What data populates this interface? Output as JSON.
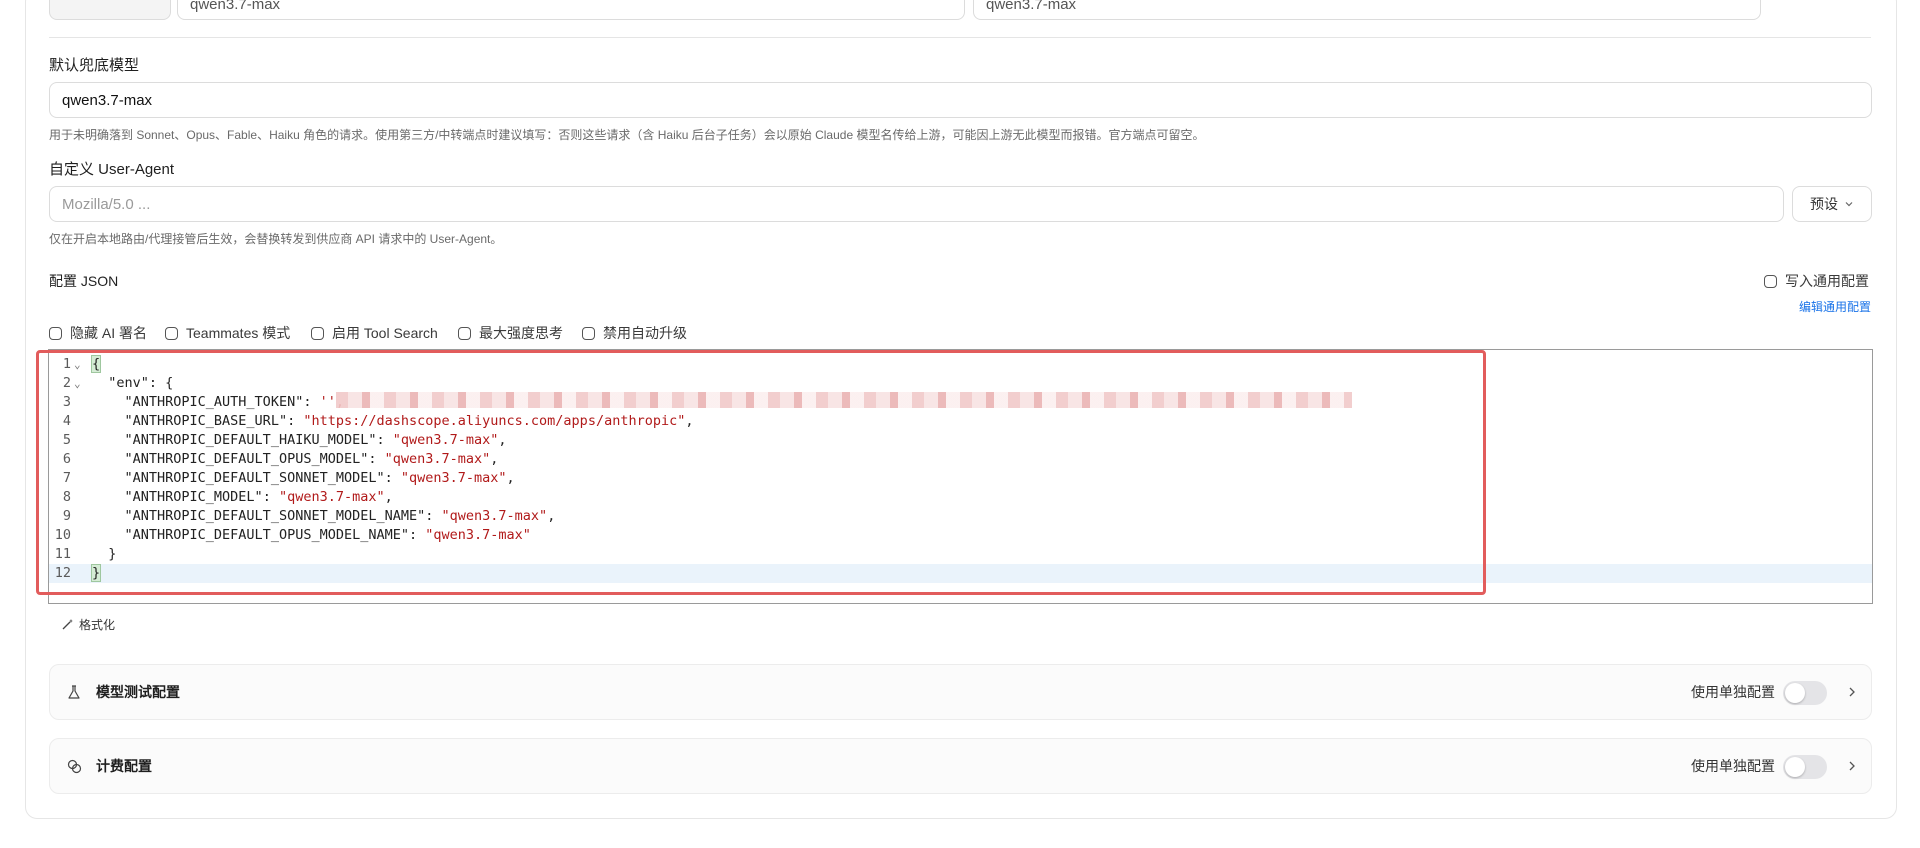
{
  "top_row": {
    "left_value": "qwen3.7-max",
    "right_value": "qwen3.7-max"
  },
  "fallback_model": {
    "label": "默认兜底模型",
    "value": "qwen3.7-max",
    "hint": "用于未明确落到 Sonnet、Opus、Fable、Haiku 角色的请求。使用第三方/中转端点时建议填写：否则这些请求（含 Haiku 后台子任务）会以原始 Claude 模型名传给上游，可能因上游无此模型而报错。官方端点可留空。"
  },
  "user_agent": {
    "label": "自定义 User-Agent",
    "placeholder": "Mozilla/5.0 ...",
    "preset_label": "预设",
    "hint": "仅在开启本地路由/代理接管后生效，会替换转发到供应商 API 请求中的 User-Agent。"
  },
  "config_json": {
    "label": "配置 JSON",
    "write_common_label": "写入通用配置",
    "edit_common_link": "编辑通用配置",
    "options": [
      "隐藏 AI 署名",
      "Teammates 模式",
      "启用 Tool Search",
      "最大强度思考",
      "禁用自动升级"
    ],
    "format_label": "格式化"
  },
  "editor": {
    "lines": [
      {
        "n": "1",
        "fold": true,
        "indent": "",
        "key": "",
        "value": "",
        "text": "{",
        "tail": ""
      },
      {
        "n": "2",
        "fold": true,
        "indent": "  ",
        "key": "\"env\"",
        "value": "",
        "text": ": {",
        "tail": ""
      },
      {
        "n": "3",
        "fold": false,
        "indent": "    ",
        "key": "\"ANTHROPIC_AUTH_TOKEN\"",
        "value": "'",
        "text": ": ",
        "tail": "',"
      },
      {
        "n": "4",
        "fold": false,
        "indent": "    ",
        "key": "\"ANTHROPIC_BASE_URL\"",
        "value": "\"https://dashscope.aliyuncs.com/apps/anthropic\"",
        "text": ": ",
        "tail": ","
      },
      {
        "n": "5",
        "fold": false,
        "indent": "    ",
        "key": "\"ANTHROPIC_DEFAULT_HAIKU_MODEL\"",
        "value": "\"qwen3.7-max\"",
        "text": ": ",
        "tail": ","
      },
      {
        "n": "6",
        "fold": false,
        "indent": "    ",
        "key": "\"ANTHROPIC_DEFAULT_OPUS_MODEL\"",
        "value": "\"qwen3.7-max\"",
        "text": ": ",
        "tail": ","
      },
      {
        "n": "7",
        "fold": false,
        "indent": "    ",
        "key": "\"ANTHROPIC_DEFAULT_SONNET_MODEL\"",
        "value": "\"qwen3.7-max\"",
        "text": ": ",
        "tail": ","
      },
      {
        "n": "8",
        "fold": false,
        "indent": "    ",
        "key": "\"ANTHROPIC_MODEL\"",
        "value": "\"qwen3.7-max\"",
        "text": ": ",
        "tail": ","
      },
      {
        "n": "9",
        "fold": false,
        "indent": "    ",
        "key": "\"ANTHROPIC_DEFAULT_SONNET_MODEL_NAME\"",
        "value": "\"qwen3.7-max\"",
        "text": ": ",
        "tail": ","
      },
      {
        "n": "10",
        "fold": false,
        "indent": "    ",
        "key": "\"ANTHROPIC_DEFAULT_OPUS_MODEL_NAME\"",
        "value": "\"qwen3.7-max\"",
        "text": ": ",
        "tail": ""
      },
      {
        "n": "11",
        "fold": false,
        "indent": "  ",
        "key": "",
        "value": "",
        "text": "}",
        "tail": ""
      },
      {
        "n": "12",
        "fold": false,
        "indent": "",
        "key": "",
        "value": "",
        "text": "}",
        "tail": ""
      }
    ]
  },
  "sections": [
    {
      "title": "模型测试配置",
      "icon": "flask-icon",
      "toggle_label": "使用单独配置",
      "enabled": false
    },
    {
      "title": "计费配置",
      "icon": "coins-icon",
      "toggle_label": "使用单独配置",
      "enabled": false
    }
  ],
  "colors": {
    "accent_link": "#1a73e8",
    "highlight_frame": "#e25c5c",
    "string": "#b11a1a"
  }
}
